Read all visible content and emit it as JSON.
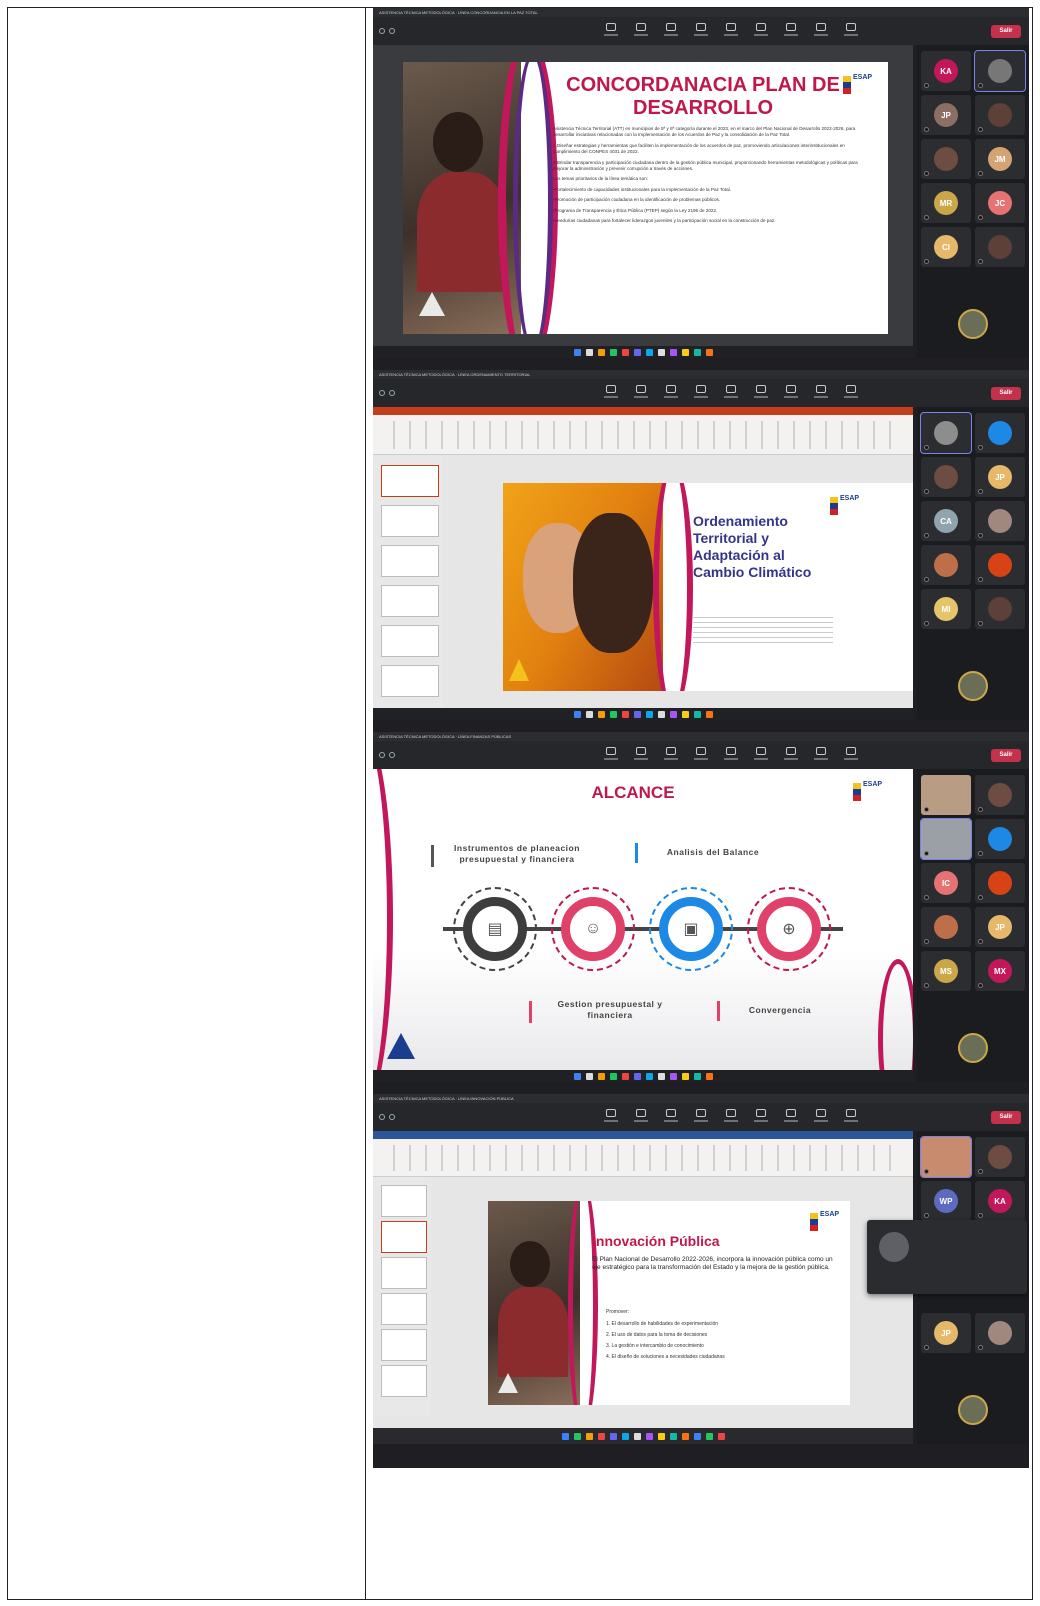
{
  "screens": [
    {
      "window_title": "ASISTENCIA TÉCNICA METODOLÓGICA · LÍNEA CONCORDANCIA EN LA PAZ TOTAL",
      "leave_label": "Salir",
      "presenter_caption": "",
      "slide": {
        "title": "CONCORDANACIA PLAN DE DESARROLLO",
        "logo": "ESAP",
        "body": [
          "Asistencia Técnica Territorial (ATT) en municipios de 5ª y 6ª categoría durante el 2023, en el marco del Plan Nacional de Desarrollo 2022-2026, para desarrollar iniciativas relacionadas con la Implementación de los Acuerdos de Paz y la consolidación de la Paz Total.",
          "1.Diseñar estrategias y herramientas que faciliten la implementación de los acuerdos de paz, promoviendo articulaciones interinstitucionales en cumplimiento del CONPES 4031 de 2022.",
          "2.Brindar transparencia y participación ciudadana dentro de la gestión pública municipal, proporcionando herramientas metodológicas y políticas para mejorar la administración y prevenir corrupción a través de acciones.",
          "Los temas prioritarios de la línea temática son:",
          "•Fortalecimiento de capacidades institucionales para la implementación de la Paz Total.",
          "•Promoción de participación ciudadana en la identificación de problemas públicos.",
          "•Programa de Transparencia y Ética Pública (PTEP) según la Ley 2195 de 2022.",
          "•Veedurías ciudadanas para fortalecer liderazgos juveniles y la participación social en la construcción de paz."
        ]
      },
      "participants": [
        "KA",
        "",
        "JP",
        "",
        "",
        "JM",
        "MR",
        "JC",
        "CI",
        ""
      ]
    },
    {
      "window_title": "ASISTENCIA TÉCNICA METODOLÓGICA · LÍNEA ORDENAMIENTO TERRITORIAL",
      "leave_label": "Salir",
      "slide": {
        "title": "Ordenamiento Territorial y Adaptación al Cambio Climático",
        "logo": "ESAP"
      },
      "participants": [
        "",
        "",
        "",
        "JP",
        "CA",
        "",
        "",
        "",
        "MI",
        ""
      ]
    },
    {
      "window_title": "ASISTENCIA TÉCNICA METODOLÓGICA · LÍNEA FINANZAS PÚBLICAS",
      "leave_label": "Salir",
      "slide": {
        "title": "ALCANCE",
        "logo": "ESAP",
        "labels": {
          "planning": "Instrumentos de planeacion presupuestal y financiera",
          "balance": "Analisis del Balance",
          "budget": "Gestion presupuestal y financiera",
          "convergence": "Convergencia"
        }
      },
      "participants": [
        "",
        "",
        "",
        "",
        "IC",
        "",
        "",
        "JP",
        "MS",
        "MX"
      ]
    },
    {
      "window_title": "ASISTENCIA TÉCNICA METODOLÓGICA · LÍNEA INNOVACIÓN PÚBLICA",
      "leave_label": "Salir",
      "slide": {
        "title": "Innovación Pública",
        "logo": "ESAP",
        "intro": "El Plan Nacional de Desarrollo 2022-2026, incorpora la innovación pública como un eje estratégico para la transformación del Estado y la mejora de la gestión pública.",
        "promote_label": "Promover:",
        "items": [
          "1.  El desarrollo de habilidades de experimentación",
          "2.  El uso de datos para la toma de decisiones",
          "3.  La gestión e intercambio de conocimiento",
          "4.  El diseño de soluciones a necesidades ciudadanas"
        ]
      },
      "participants": [
        "",
        "",
        "WP",
        "KA",
        "",
        "",
        "",
        "",
        "JP",
        ""
      ]
    }
  ],
  "colors": {
    "accent_red": "#c0184b",
    "accent_purple": "#5b2b84",
    "teams_bg": "#1f1f23",
    "leave_red": "#c4314b",
    "blue_ring": "#1e88e5",
    "dark_ring": "#3d3d3d"
  },
  "icons": [
    "camera-icon",
    "share-icon",
    "people-icon",
    "raise-hand-icon",
    "react-icon",
    "view-icon",
    "more-icon"
  ]
}
